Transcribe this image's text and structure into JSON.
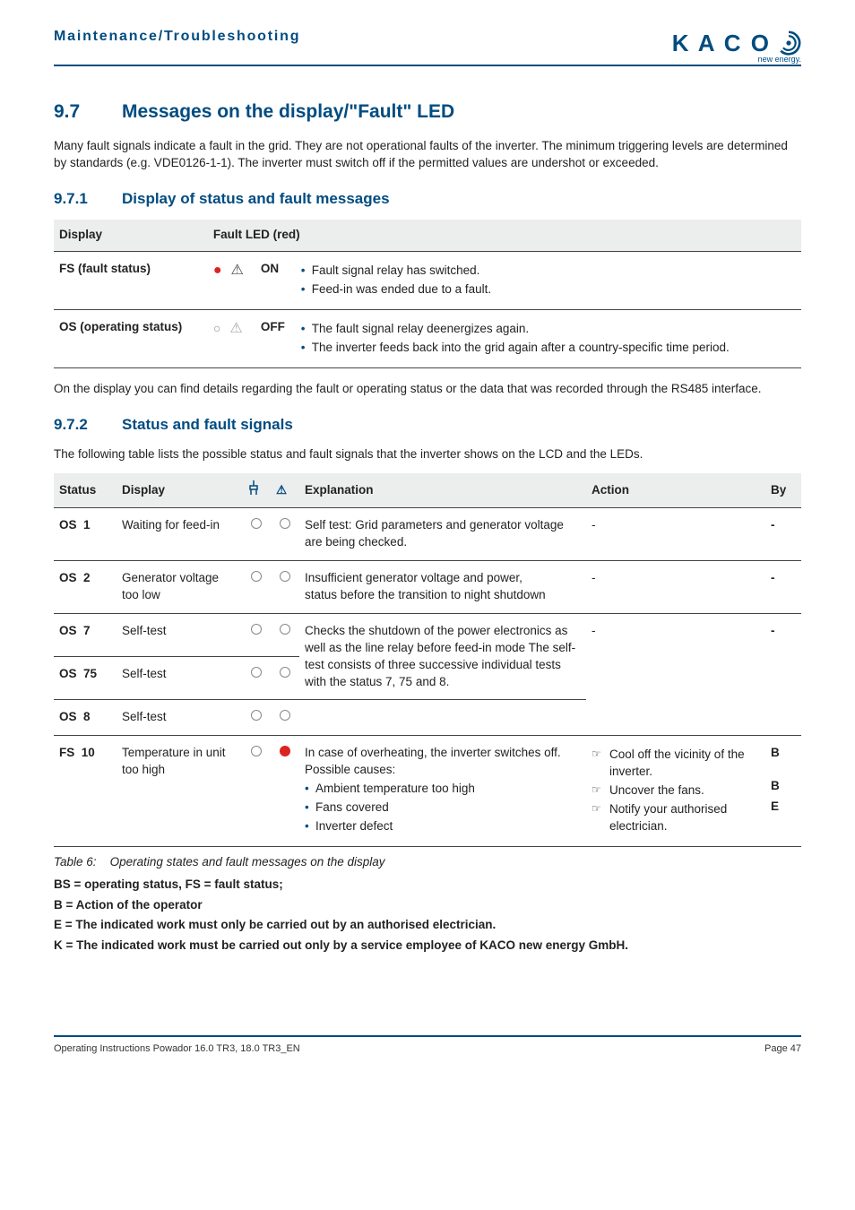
{
  "header": {
    "title": "Maintenance/Troubleshooting",
    "logo_text": "K A C O",
    "logo_sub": "new energy."
  },
  "sec97": {
    "num": "9.7",
    "title": "Messages on the display/\"Fault\" LED",
    "intro": "Many fault signals indicate a fault in the grid. They are not operational faults of the inverter. The minimum triggering levels are determined by standards (e.g. VDE0126-1-1). The inverter must switch off if the permitted values are undershot or exceeded."
  },
  "sec971": {
    "num": "9.7.1",
    "title": "Display of status and fault messages",
    "table": {
      "head_display": "Display",
      "head_fault": "Fault LED (red)",
      "rows": [
        {
          "label": "FS (fault status)",
          "led_red": true,
          "tri_on": true,
          "state": "ON",
          "items": [
            "Fault signal relay has switched.",
            "Feed-in was ended due to a fault."
          ]
        },
        {
          "label": "OS (operating status)",
          "led_red": false,
          "tri_on": false,
          "state": "OFF",
          "items": [
            "The fault signal relay deenergizes again.",
            "The inverter feeds back into the grid again after a country-specific time period."
          ]
        }
      ]
    },
    "outro": "On the display you can find details regarding the fault or operating status or the data that was recorded through the RS485 interface."
  },
  "sec972": {
    "num": "9.7.2",
    "title": "Status and fault signals",
    "intro": "The following table lists the possible status and fault signals that the inverter shows on the LCD and the LEDs.",
    "headers": {
      "status": "Status",
      "display": "Display",
      "explanation": "Explanation",
      "action": "Action",
      "by": "By"
    },
    "rows": [
      {
        "status_code": "OS",
        "status_num": "1",
        "display": "Waiting for feed-in",
        "led1": "off",
        "led2": "off",
        "explanation_text": "Self test: Grid parameters and generator voltage are being checked.",
        "action_text": "-",
        "by": "-"
      },
      {
        "status_code": "OS",
        "status_num": "2",
        "display": "Generator voltage too low",
        "led1": "off",
        "led2": "off",
        "explanation_text": "Insufficient generator voltage and power,",
        "explanation_text2": "status before the transition to night shutdown",
        "action_text": "-",
        "by": "-"
      },
      {
        "status_code": "OS",
        "status_num": "7",
        "display": "Self-test",
        "led1": "off",
        "led2": "off",
        "explanation_text": "Checks the shutdown of the power electronics as well as the line relay before feed-in mode The self-test consists of three successive individual tests with the status 7, 75 and 8.",
        "action_text": "-",
        "by": "-",
        "group_start": true
      },
      {
        "status_code": "OS",
        "status_num": "75",
        "display": "Self-test",
        "led1": "off",
        "led2": "off",
        "group_mid": true
      },
      {
        "status_code": "OS",
        "status_num": "8",
        "display": "Self-test",
        "led1": "off",
        "led2": "off",
        "group_end": true
      },
      {
        "status_code": "FS",
        "status_num": "10",
        "display": "Temperature in unit too high",
        "led1": "off",
        "led2": "red",
        "explanation_text": "In case of overheating, the inverter switches off. Possible causes:",
        "explanation_items": [
          "Ambient temperature too high",
          "Fans covered",
          "Inverter defect"
        ],
        "action_items": [
          "Cool off the vicinity of the inverter.",
          "Uncover the fans.",
          "Notify your authorised electrician."
        ],
        "by_items": [
          "B",
          "B",
          "E"
        ]
      }
    ],
    "caption_label": "Table 6:",
    "caption_text": "Operating states and fault messages on the display",
    "defs": [
      "BS = operating status, FS = fault status;",
      "B = Action of the operator",
      "E = The indicated work must only be carried out by an authorised electrician.",
      "K = The indicated work must be carried out only by a service employee of KACO new energy GmbH."
    ]
  },
  "footer": {
    "left": "Operating Instructions Powador 16.0 TR3, 18.0 TR3_EN",
    "right": "Page 47"
  }
}
